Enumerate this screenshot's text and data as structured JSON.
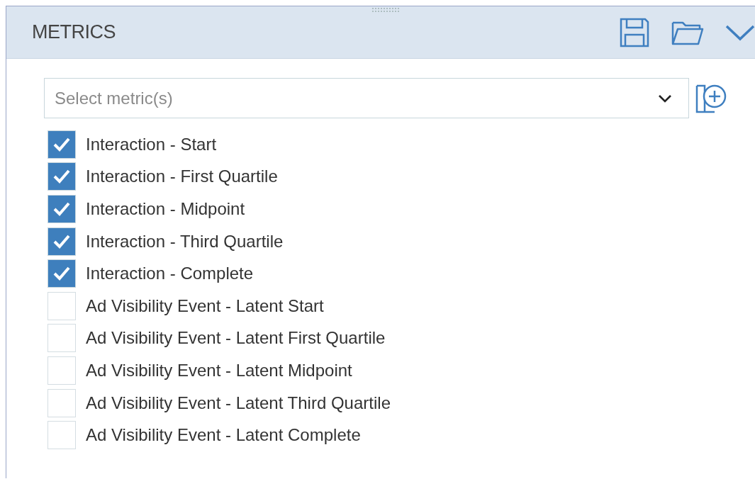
{
  "panel": {
    "title": "METRICS"
  },
  "metric_select": {
    "placeholder": "Select metric(s)"
  },
  "metrics": [
    {
      "label": "Interaction - Start",
      "checked": true
    },
    {
      "label": "Interaction - First Quartile",
      "checked": true
    },
    {
      "label": "Interaction - Midpoint",
      "checked": true
    },
    {
      "label": "Interaction - Third Quartile",
      "checked": true
    },
    {
      "label": "Interaction - Complete",
      "checked": true
    },
    {
      "label": "Ad Visibility Event - Latent Start",
      "checked": false
    },
    {
      "label": "Ad Visibility Event - Latent First Quartile",
      "checked": false
    },
    {
      "label": "Ad Visibility Event - Latent Midpoint",
      "checked": false
    },
    {
      "label": "Ad Visibility Event - Latent Third Quartile",
      "checked": false
    },
    {
      "label": "Ad Visibility Event - Latent Complete",
      "checked": false
    }
  ]
}
